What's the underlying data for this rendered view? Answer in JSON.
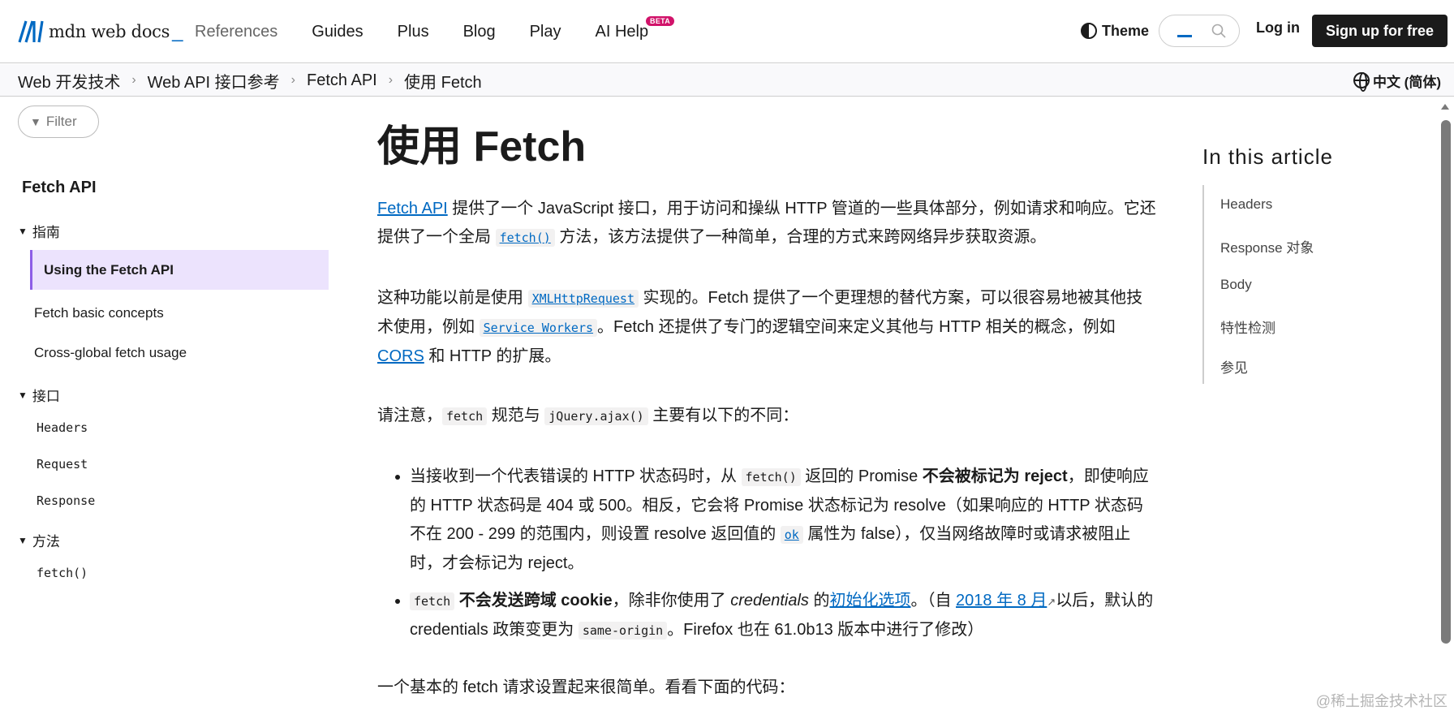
{
  "header": {
    "logo_text": "mdn web docs",
    "logo_suffix": "_",
    "nav": [
      "References",
      "Guides",
      "Plus",
      "Blog",
      "Play",
      "AI Help"
    ],
    "beta_badge": "BETA",
    "theme_label": "Theme",
    "login_label": "Log in",
    "signup_label": "Sign up for free"
  },
  "breadcrumb": {
    "items": [
      "Web 开发技术",
      "Web API 接口参考",
      "Fetch API",
      "使用 Fetch"
    ],
    "language": "中文 (简体)"
  },
  "sidebar": {
    "filter_placeholder": "Filter",
    "title": "Fetch API",
    "group_guides": "指南",
    "active_item": "Using the Fetch API",
    "guide_links": [
      "Fetch basic concepts",
      "Cross-global fetch usage"
    ],
    "group_interfaces": "接口",
    "interfaces": [
      "Headers",
      "Request",
      "Response"
    ],
    "group_methods": "方法",
    "methods": [
      "fetch()"
    ]
  },
  "article": {
    "title": "使用 Fetch",
    "p1": {
      "link_fetch_api": "Fetch API",
      "text_a": " 提供了一个 JavaScript 接口，用于访问和操纵 HTTP 管道的一些具体部分，例如请求和响应。它还提供了一个全局 ",
      "code_fetch": "fetch()",
      "text_b": " 方法，该方法提供了一种简单，合理的方式来跨网络异步获取资源。"
    },
    "p2": {
      "text_a": "这种功能以前是使用 ",
      "code_xhr": "XMLHttpRequest",
      "text_b": " 实现的。Fetch 提供了一个更理想的替代方案，可以很容易地被其他技术使用，例如 ",
      "code_sw": "Service Workers",
      "text_c": "。Fetch 还提供了专门的逻辑空间来定义其他与 HTTP 相关的概念，例如 ",
      "link_cors": "CORS",
      "text_d": " 和 HTTP 的扩展。"
    },
    "p3": {
      "text_a": "请注意，",
      "code_fetch": "fetch",
      "text_b": " 规范与 ",
      "code_ajax": "jQuery.ajax()",
      "text_c": " 主要有以下的不同："
    },
    "bullet1": {
      "text_a": "当接收到一个代表错误的 HTTP 状态码时，从 ",
      "code_fetch": "fetch()",
      "text_b": " 返回的 Promise ",
      "bold": "不会被标记为 reject",
      "text_c": "，即使响应的 HTTP 状态码是 404 或 500。相反，它会将 Promise 状态标记为 resolve（如果响应的 HTTP 状态码不在 200 - 299 的范围内，则设置 resolve 返回值的 ",
      "code_ok": "ok",
      "text_d": " 属性为 false），仅当网络故障时或请求被阻止时，才会标记为 reject。"
    },
    "bullet2": {
      "code_fetch": "fetch",
      "bold": " 不会发送跨域 cookie",
      "text_a": "，除非你使用了 ",
      "italic": "credentials",
      "text_b": " 的",
      "link_init": "初始化选项",
      "text_c": "。（自 ",
      "link_date": "2018 年 8 月",
      "ext_icon": "↗",
      "text_d": "以后，默认的 credentials 政策变更为 ",
      "code_same_origin": "same-origin",
      "text_e": "。Firefox 也在 61.0b13 版本中进行了修改）"
    },
    "p4": "一个基本的 fetch 请求设置起来很简单。看看下面的代码："
  },
  "toc": {
    "title": "In this article",
    "items": [
      "Headers",
      "Response 对象",
      "Body",
      "特性检测",
      "参见"
    ]
  },
  "watermark": "@稀土掘金技术社区",
  "colors": {
    "link": "#0069c2",
    "active_bg": "#ece3fd",
    "active_border": "#8d5ee6",
    "beta": "#d1136a"
  }
}
